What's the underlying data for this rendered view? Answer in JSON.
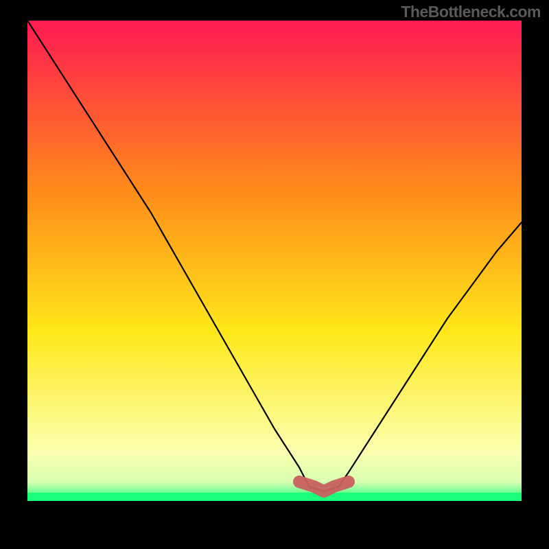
{
  "watermark": "TheBottleneck.com",
  "chart_data": {
    "type": "line",
    "title": "",
    "xlabel": "",
    "ylabel": "",
    "xlim": [
      0,
      100
    ],
    "ylim": [
      0,
      100
    ],
    "background_gradient": {
      "top": "#ff1a52",
      "mid1": "#ff8a1a",
      "mid2": "#ffe81a",
      "lower": "#faffb0",
      "bottom": "#1aff7a"
    },
    "curve": {
      "x": [
        0,
        5,
        10,
        15,
        20,
        25,
        30,
        35,
        40,
        45,
        50,
        55,
        57,
        60,
        63,
        65,
        70,
        75,
        80,
        85,
        90,
        95,
        100
      ],
      "y": [
        100,
        92,
        84,
        76,
        68,
        60,
        51,
        42,
        33,
        24,
        15,
        7,
        3,
        2,
        3,
        6,
        14,
        22,
        30,
        38,
        45,
        52,
        58
      ]
    },
    "marker_flat": {
      "x": [
        55,
        58,
        60,
        62,
        65
      ],
      "y": [
        4,
        3,
        2,
        3,
        4
      ],
      "color": "#c86060"
    }
  }
}
